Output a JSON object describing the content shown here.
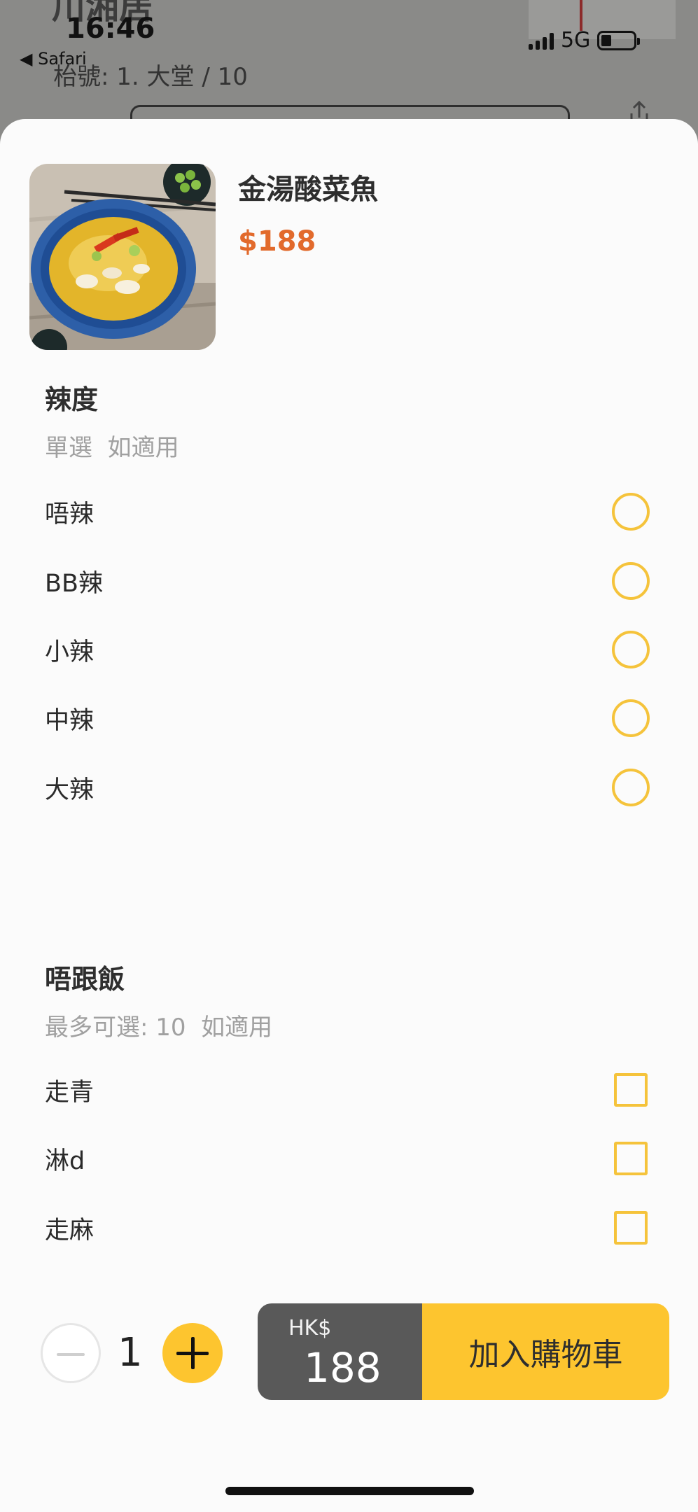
{
  "status_bar": {
    "time": "16:46",
    "back_app": "◀ Safari",
    "network": "5G"
  },
  "background_page": {
    "title": "川湘居",
    "table": "枱號: 1. 大堂 / 10"
  },
  "dish": {
    "name": "金湯酸菜魚",
    "price": "$188",
    "photo_icon": "fish-soup-photo"
  },
  "spice_group": {
    "title": "辣度",
    "subtitle": "單選  如適用",
    "options": [
      {
        "label": "唔辣"
      },
      {
        "label": "BB辣"
      },
      {
        "label": "小辣"
      },
      {
        "label": "中辣"
      },
      {
        "label": "大辣"
      }
    ]
  },
  "rice_group": {
    "title": "唔跟飯",
    "subtitle": "最多可選: 10  如適用",
    "options": [
      {
        "label": "走青"
      },
      {
        "label": "淋d"
      },
      {
        "label": "走麻"
      }
    ]
  },
  "quantity": {
    "value": "1"
  },
  "cart": {
    "currency": "HK$",
    "amount": "188",
    "add_label": "加入購物車"
  },
  "colors": {
    "accent": "#fdc52f",
    "price": "#e26a2c",
    "option_border": "#f5c33b"
  }
}
